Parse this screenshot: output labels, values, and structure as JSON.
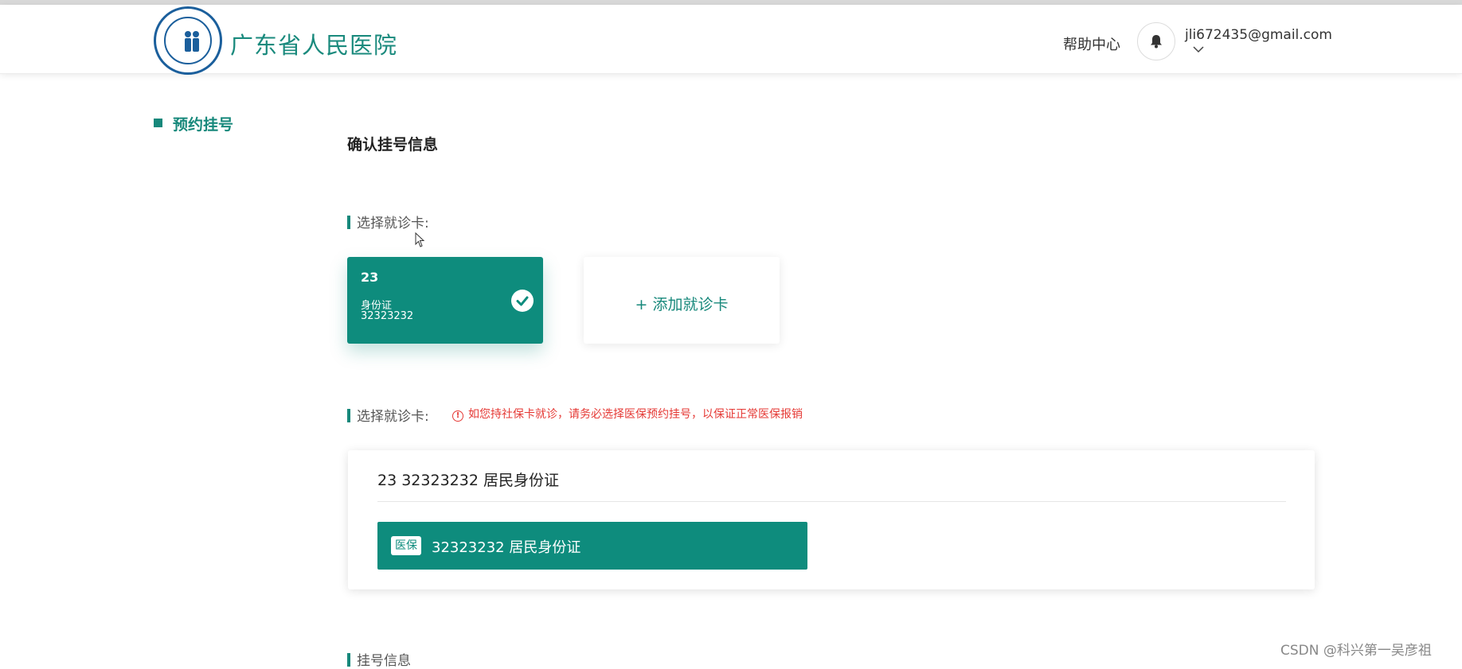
{
  "header": {
    "site_title": "广东省人民医院",
    "help_label": "帮助中心",
    "user_email": "jli672435@gmail.com"
  },
  "sidebar": {
    "items": [
      {
        "label": "预约挂号"
      }
    ]
  },
  "main": {
    "title": "确认挂号信息",
    "card_section": {
      "label": "选择就诊卡:",
      "selected_card": {
        "number": "23",
        "type": "身份证",
        "id_number": "32323232"
      },
      "add_card_label": "+ 添加就诊卡"
    },
    "insurance_section": {
      "label": "选择就诊卡:",
      "warning": "如您持社保卡就诊，请务必选择医保预约挂号，以保证正常医保报销",
      "box_header": "23 32323232 居民身份证",
      "option": {
        "badge": "医保",
        "text": "32323232  居民身份证"
      }
    },
    "registration_section": {
      "label": "挂号信息"
    }
  },
  "watermark": "CSDN @科兴第一吴彦祖",
  "colors": {
    "accent": "#0e8c7d",
    "warning": "#e53935"
  },
  "icons": [
    "hospital-logo-icon",
    "bell-icon",
    "chevron-down-icon",
    "checkmark-icon",
    "warning-circle-icon",
    "cursor-icon"
  ]
}
